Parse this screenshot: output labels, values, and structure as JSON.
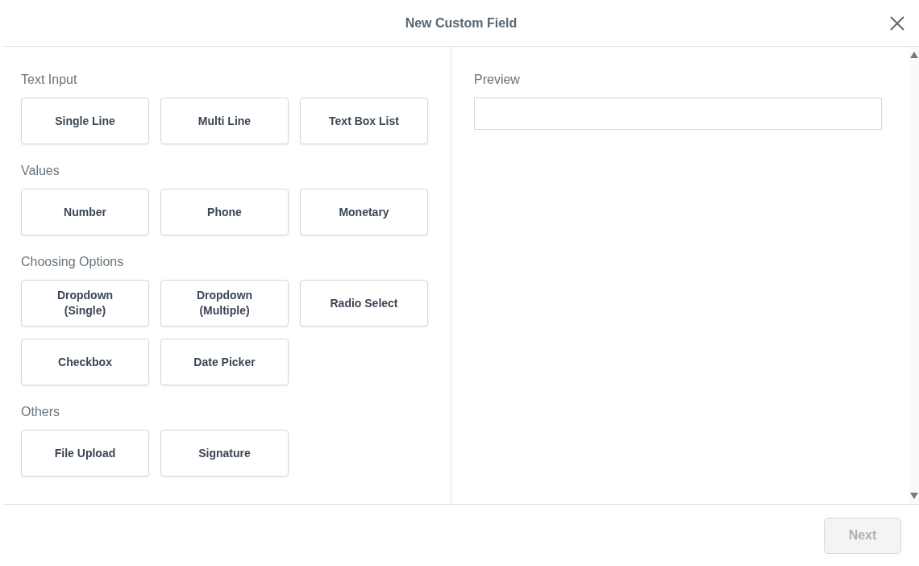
{
  "dialog": {
    "title": "New Custom Field"
  },
  "sections": [
    {
      "heading": "Text Input",
      "items": [
        "Single Line",
        "Multi Line",
        "Text Box List"
      ]
    },
    {
      "heading": "Values",
      "items": [
        "Number",
        "Phone",
        "Monetary"
      ]
    },
    {
      "heading": "Choosing Options",
      "items": [
        "Dropdown\n(Single)",
        "Dropdown\n(Multiple)",
        "Radio Select",
        "Checkbox",
        "Date Picker"
      ]
    },
    {
      "heading": "Others",
      "items": [
        "File Upload",
        "Signature"
      ]
    }
  ],
  "preview": {
    "label": "Preview"
  },
  "footer": {
    "next": {
      "label": "Next",
      "disabled": true
    }
  }
}
